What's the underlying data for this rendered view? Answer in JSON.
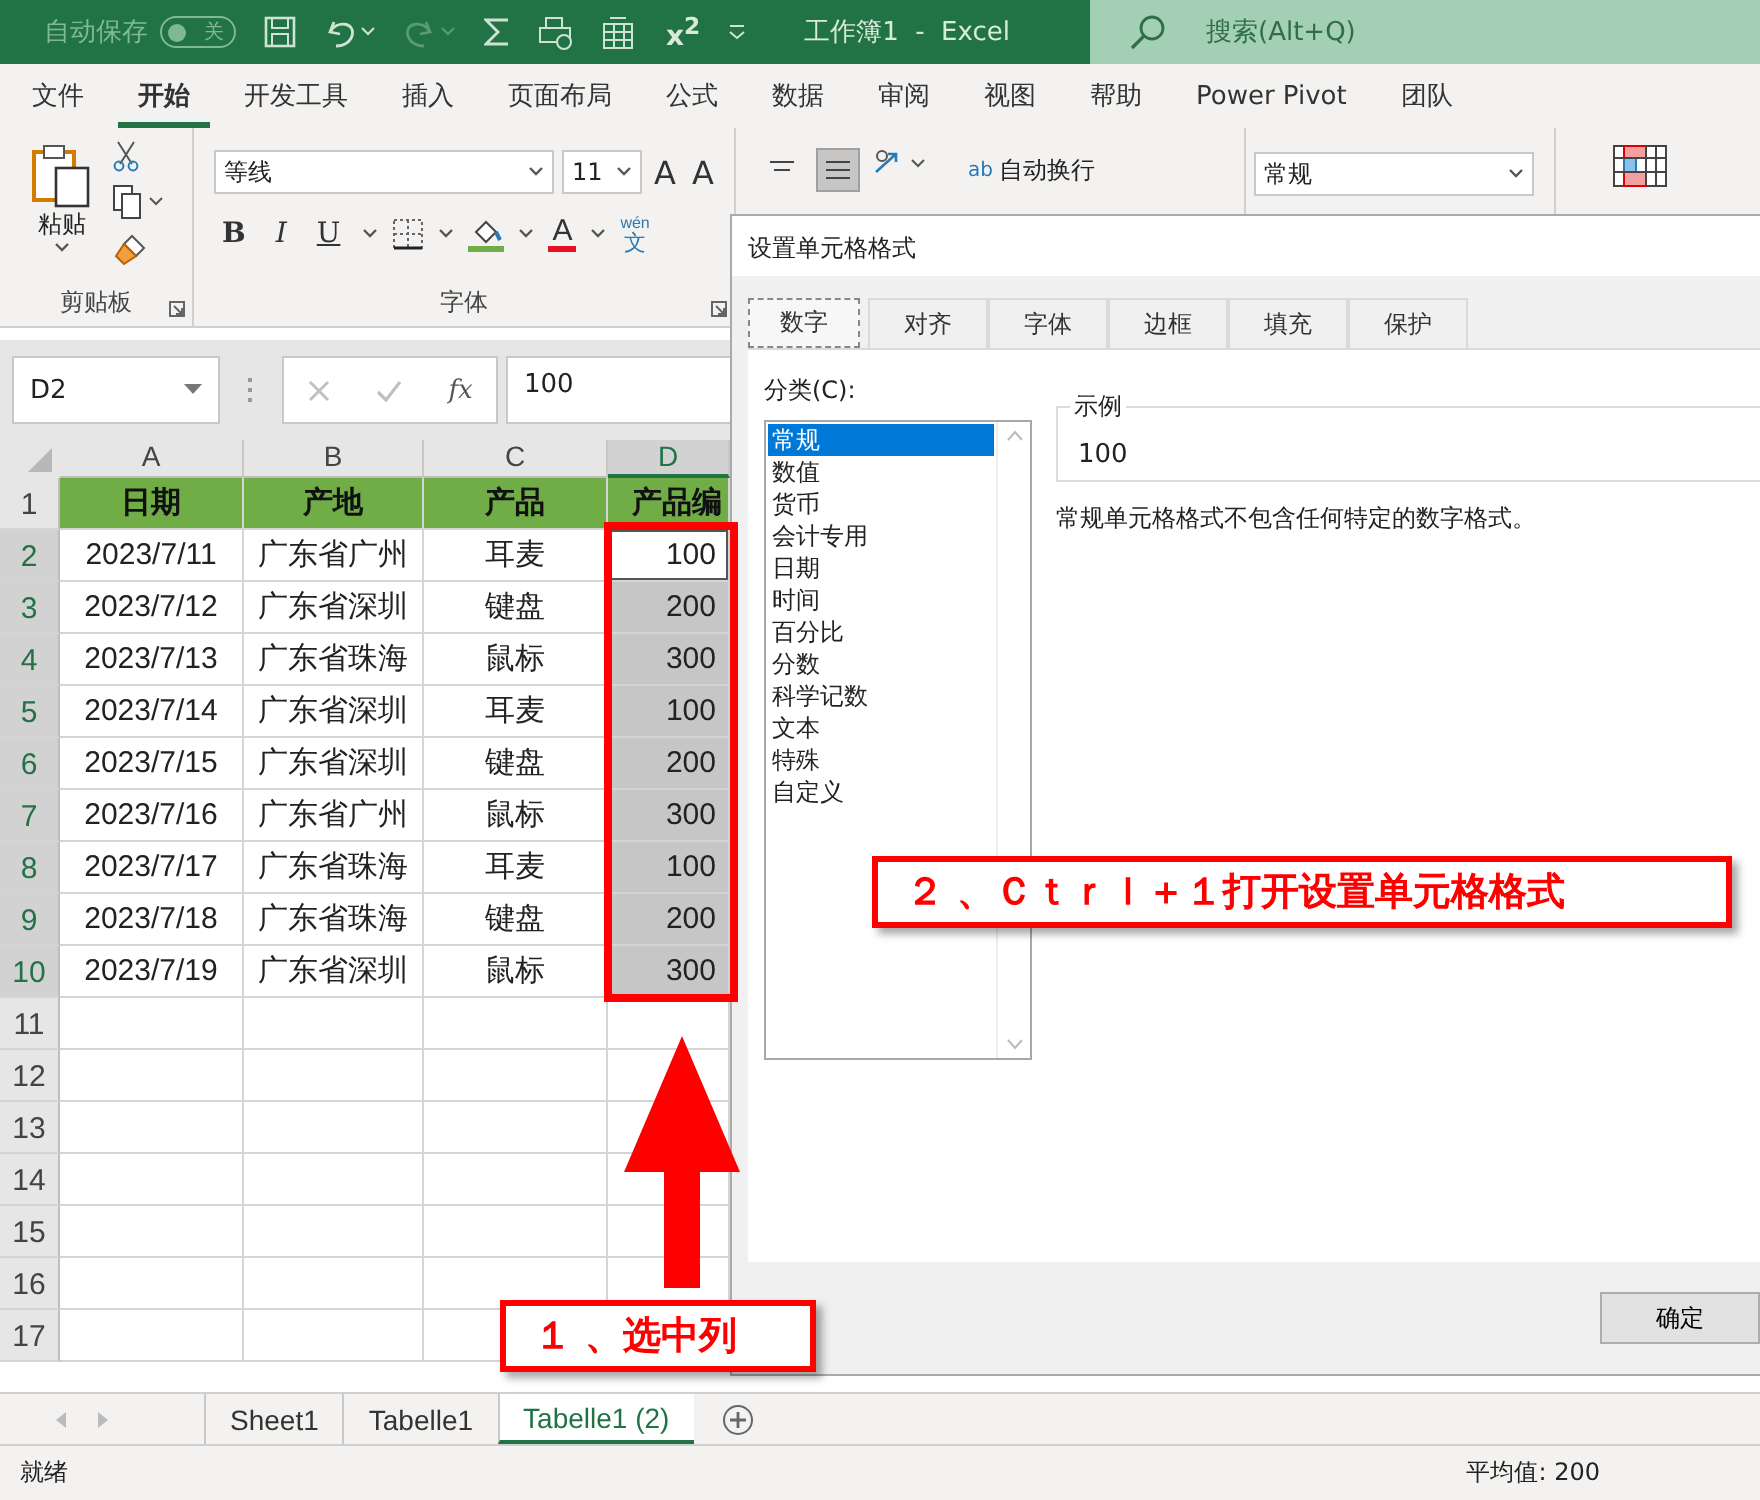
{
  "title_bar": {
    "autosave_label": "自动保存",
    "autosave_toggle": {
      "label": "关",
      "on": false
    },
    "superscript": "x$^{2}$",
    "title": "工作簿1  -  Excel",
    "search": {
      "placeholder": "搜索(Alt+Q)"
    }
  },
  "ribbon_tabs": [
    {
      "label": "文件",
      "selected": false
    },
    {
      "label": "开始",
      "selected": true
    },
    {
      "label": "开发工具",
      "selected": false
    },
    {
      "label": "插入",
      "selected": false
    },
    {
      "label": "页面布局",
      "selected": false
    },
    {
      "label": "公式",
      "selected": false
    },
    {
      "label": "数据",
      "selected": false
    },
    {
      "label": "审阅",
      "selected": false
    },
    {
      "label": "视图",
      "selected": false
    },
    {
      "label": "帮助",
      "selected": false
    },
    {
      "label": "Power Pivot",
      "selected": false
    },
    {
      "label": "团队",
      "selected": false
    }
  ],
  "ribbon": {
    "clipboard": {
      "paste_label": "粘贴",
      "group_label": "剪贴板"
    },
    "font": {
      "font_name": "等线",
      "font_size": "11",
      "size_buttons": [
        "A",
        "A"
      ],
      "format_buttons": [
        "B",
        "I",
        "U"
      ],
      "color_buttons": [
        "A"
      ],
      "phonetic": "wén",
      "phonetic_char": "文",
      "group_label": "字体"
    },
    "alignment": {
      "wrap_text_label": "自动换行",
      "wrap_icon": "ab"
    },
    "number": {
      "format": "常规"
    }
  },
  "formula_bar": {
    "name_box": "D2",
    "fx": "fx",
    "formula": "100"
  },
  "sheet": {
    "columns": [
      {
        "label": "A",
        "selected": false
      },
      {
        "label": "B",
        "selected": false
      },
      {
        "label": "C",
        "selected": false
      },
      {
        "label": "D",
        "selected": true
      }
    ],
    "row_headers": [
      {
        "label": "1",
        "selected": false
      },
      {
        "label": "2",
        "selected": true
      },
      {
        "label": "3",
        "selected": true
      },
      {
        "label": "4",
        "selected": true
      },
      {
        "label": "5",
        "selected": true
      },
      {
        "label": "6",
        "selected": true
      },
      {
        "label": "7",
        "selected": true
      },
      {
        "label": "8",
        "selected": true
      },
      {
        "label": "9",
        "selected": true
      },
      {
        "label": "10",
        "selected": true
      },
      {
        "label": "11",
        "selected": false
      },
      {
        "label": "12",
        "selected": false
      },
      {
        "label": "13",
        "selected": false
      },
      {
        "label": "14",
        "selected": false
      },
      {
        "label": "15",
        "selected": false
      },
      {
        "label": "16",
        "selected": false
      },
      {
        "label": "17",
        "selected": false
      }
    ],
    "header_row": [
      "日期",
      "产地",
      "产品",
      "产品编"
    ],
    "rows": [
      {
        "cells": [
          "2023/7/11",
          "广东省广州",
          "耳麦",
          "100"
        ],
        "active": true,
        "selected": true
      },
      {
        "cells": [
          "2023/7/12",
          "广东省深圳",
          "键盘",
          "200"
        ],
        "active": false,
        "selected": true
      },
      {
        "cells": [
          "2023/7/13",
          "广东省珠海",
          "鼠标",
          "300"
        ],
        "active": false,
        "selected": true
      },
      {
        "cells": [
          "2023/7/14",
          "广东省深圳",
          "耳麦",
          "100"
        ],
        "active": false,
        "selected": true
      },
      {
        "cells": [
          "2023/7/15",
          "广东省深圳",
          "键盘",
          "200"
        ],
        "active": false,
        "selected": true
      },
      {
        "cells": [
          "2023/7/16",
          "广东省广州",
          "鼠标",
          "300"
        ],
        "active": false,
        "selected": true
      },
      {
        "cells": [
          "2023/7/17",
          "广东省珠海",
          "耳麦",
          "100"
        ],
        "active": false,
        "selected": true
      },
      {
        "cells": [
          "2023/7/18",
          "广东省珠海",
          "键盘",
          "200"
        ],
        "active": false,
        "selected": true
      },
      {
        "cells": [
          "2023/7/19",
          "广东省深圳",
          "鼠标",
          "300"
        ],
        "active": false,
        "selected": true
      }
    ]
  },
  "sheet_tabs": [
    {
      "label": "Sheet1",
      "selected": false
    },
    {
      "label": "Tabelle1",
      "selected": false
    },
    {
      "label": "Tabelle1 (2)",
      "selected": true
    }
  ],
  "status_bar": {
    "status": "就绪",
    "average": "平均值: 200"
  },
  "dialog": {
    "title": "设置单元格格式",
    "tabs": [
      {
        "label": "数字",
        "selected": true
      },
      {
        "label": "对齐",
        "selected": false
      },
      {
        "label": "字体",
        "selected": false
      },
      {
        "label": "边框",
        "selected": false
      },
      {
        "label": "填充",
        "selected": false
      },
      {
        "label": "保护",
        "selected": false
      }
    ],
    "category_label": "分类(C):",
    "categories": [
      {
        "label": "常规",
        "selected": true
      },
      {
        "label": "数值",
        "selected": false
      },
      {
        "label": "货币",
        "selected": false
      },
      {
        "label": "会计专用",
        "selected": false
      },
      {
        "label": "日期",
        "selected": false
      },
      {
        "label": "时间",
        "selected": false
      },
      {
        "label": "百分比",
        "selected": false
      },
      {
        "label": "分数",
        "selected": false
      },
      {
        "label": "科学记数",
        "selected": false
      },
      {
        "label": "文本",
        "selected": false
      },
      {
        "label": "特殊",
        "selected": false
      },
      {
        "label": "自定义",
        "selected": false
      }
    ],
    "sample": {
      "legend": "示例",
      "value": "100"
    },
    "description": "常规单元格格式不包含任何特定的数字格式。",
    "buttons": [
      "确定"
    ]
  },
  "annotations": [
    {
      "kind": "callout",
      "text": "２ 、Ｃｔｒｌ＋１打开设置单元格格式"
    },
    {
      "kind": "callout",
      "text": "１ 、选中列"
    },
    {
      "kind": "outline"
    },
    {
      "kind": "arrow"
    }
  ]
}
